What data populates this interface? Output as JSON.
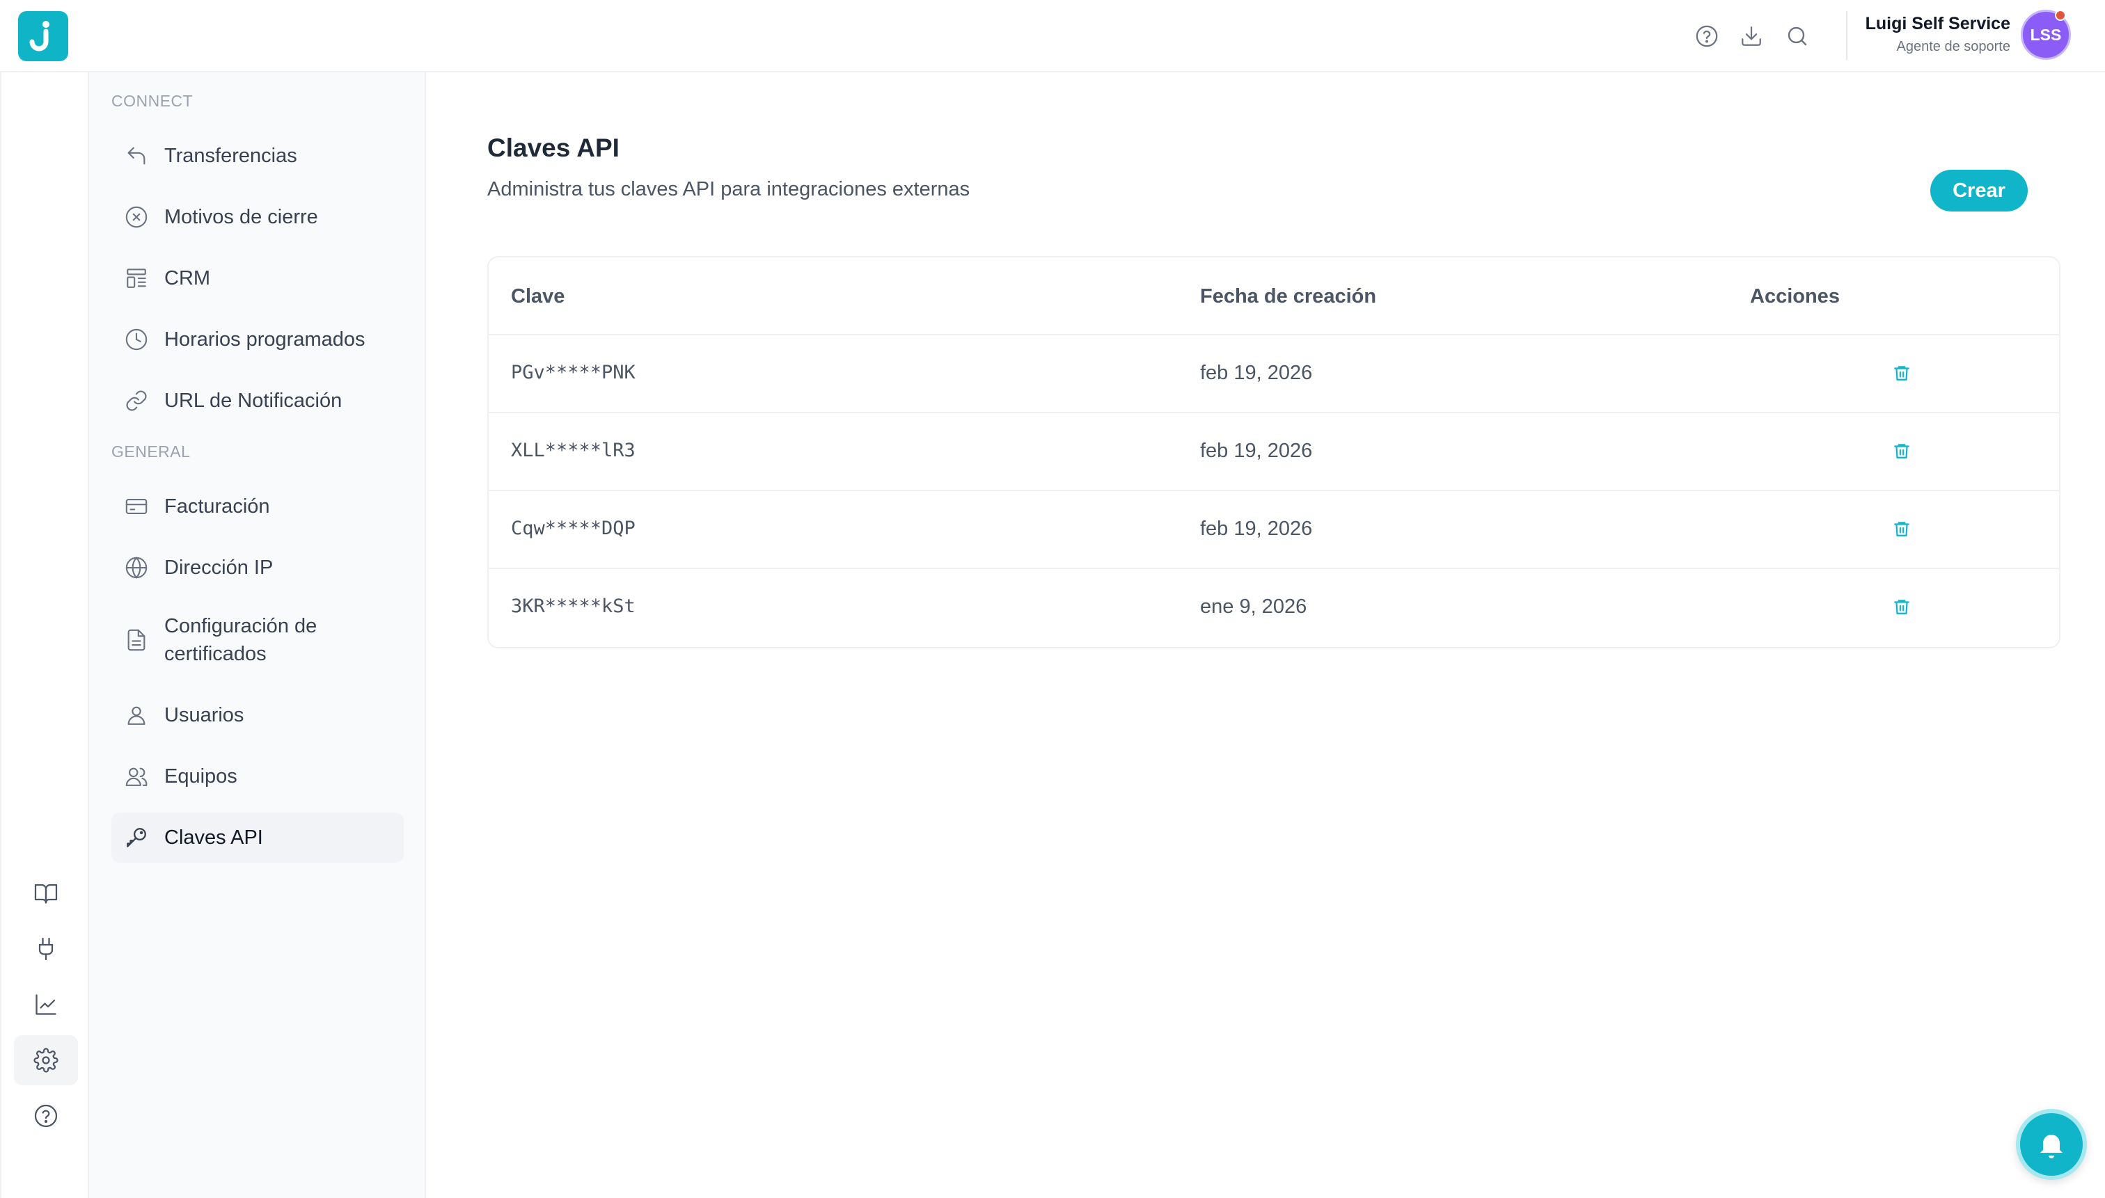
{
  "app": {
    "logo_letter": "J",
    "brand_color": "#11b5c9"
  },
  "header": {
    "icons": [
      "help-circle-icon",
      "download-icon",
      "search-icon"
    ],
    "user": {
      "name": "Luigi Self Service",
      "role": "Agente de soporte",
      "initials": "LSS",
      "avatar_color": "#8b5cf6"
    }
  },
  "rail": {
    "items": [
      "book-icon",
      "plug-icon",
      "chart-line-icon",
      "gear-icon",
      "help-circle-icon"
    ],
    "active": "gear-icon"
  },
  "sidebar": {
    "sections": [
      {
        "label": "CONNECT",
        "items": [
          {
            "label": "Transferencias",
            "icon": "reply-arrow-icon"
          },
          {
            "label": "Motivos de cierre",
            "icon": "x-circle-icon"
          },
          {
            "label": "CRM",
            "icon": "layout-list-icon"
          },
          {
            "label": "Horarios programados",
            "icon": "clock-icon"
          },
          {
            "label": "URL de Notificación",
            "icon": "link-icon"
          }
        ]
      },
      {
        "label": "GENERAL",
        "items": [
          {
            "label": "Facturación",
            "icon": "credit-card-icon"
          },
          {
            "label": "Dirección IP",
            "icon": "globe-icon"
          },
          {
            "label": "Configuración de certificados",
            "icon": "file-text-icon"
          },
          {
            "label": "Usuarios",
            "icon": "user-icon"
          },
          {
            "label": "Equipos",
            "icon": "users-icon"
          },
          {
            "label": "Claves API",
            "icon": "key-icon",
            "active": true
          }
        ]
      }
    ]
  },
  "main": {
    "title": "Claves API",
    "subtitle": "Administra tus claves API para integraciones externas",
    "create_label": "Crear",
    "table": {
      "columns": [
        "Clave",
        "Fecha de creación",
        "Acciones"
      ],
      "rows": [
        {
          "key": "PGv*****PNK",
          "created": "feb 19, 2026"
        },
        {
          "key": "XLL*****lR3",
          "created": "feb 19, 2026"
        },
        {
          "key": "Cqw*****DQP",
          "created": "feb 19, 2026"
        },
        {
          "key": "3KR*****kSt",
          "created": "ene 9, 2026"
        }
      ],
      "row_action_icon": "trash-icon"
    }
  },
  "notifications": {
    "icon": "bell-icon"
  }
}
